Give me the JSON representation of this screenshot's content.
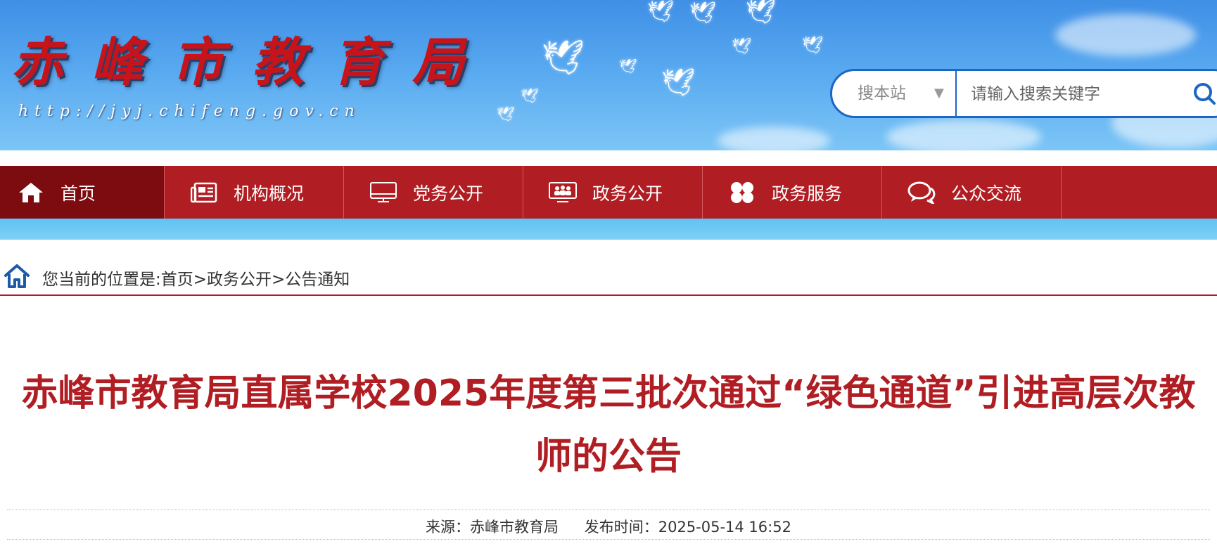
{
  "header": {
    "site_name": "赤峰市教育局",
    "site_url": "http://jyj.chifeng.gov.cn",
    "search": {
      "scope": "搜本站",
      "placeholder": "请输入搜索关键字",
      "scope_icon": "dropdown-triangle-icon",
      "button_icon": "search-icon"
    }
  },
  "nav": {
    "items": [
      {
        "label": "首页",
        "icon": "home-icon"
      },
      {
        "label": "机构概况",
        "icon": "newspaper-icon"
      },
      {
        "label": "党务公开",
        "icon": "monitor-icon"
      },
      {
        "label": "政务公开",
        "icon": "people-screen-icon"
      },
      {
        "label": "政务服务",
        "icon": "grid-icon"
      },
      {
        "label": "公众交流",
        "icon": "chat-icon"
      }
    ]
  },
  "breadcrumb": {
    "text": "您当前的位置是:首页>政务公开>公告通知",
    "icon": "home-outline-icon"
  },
  "article": {
    "title_line1": "赤峰市教育局直属学校2025年度第三批次通过“绿色通道”引进高层次教",
    "title_line2": "师的公告",
    "source": "来源：赤峰市教育局",
    "publish_time": "发布时间：2025-05-14 16:52"
  },
  "colors": {
    "brand_red": "#b01d22",
    "nav_active": "#7c0c10",
    "search_border": "#1d66c4"
  }
}
